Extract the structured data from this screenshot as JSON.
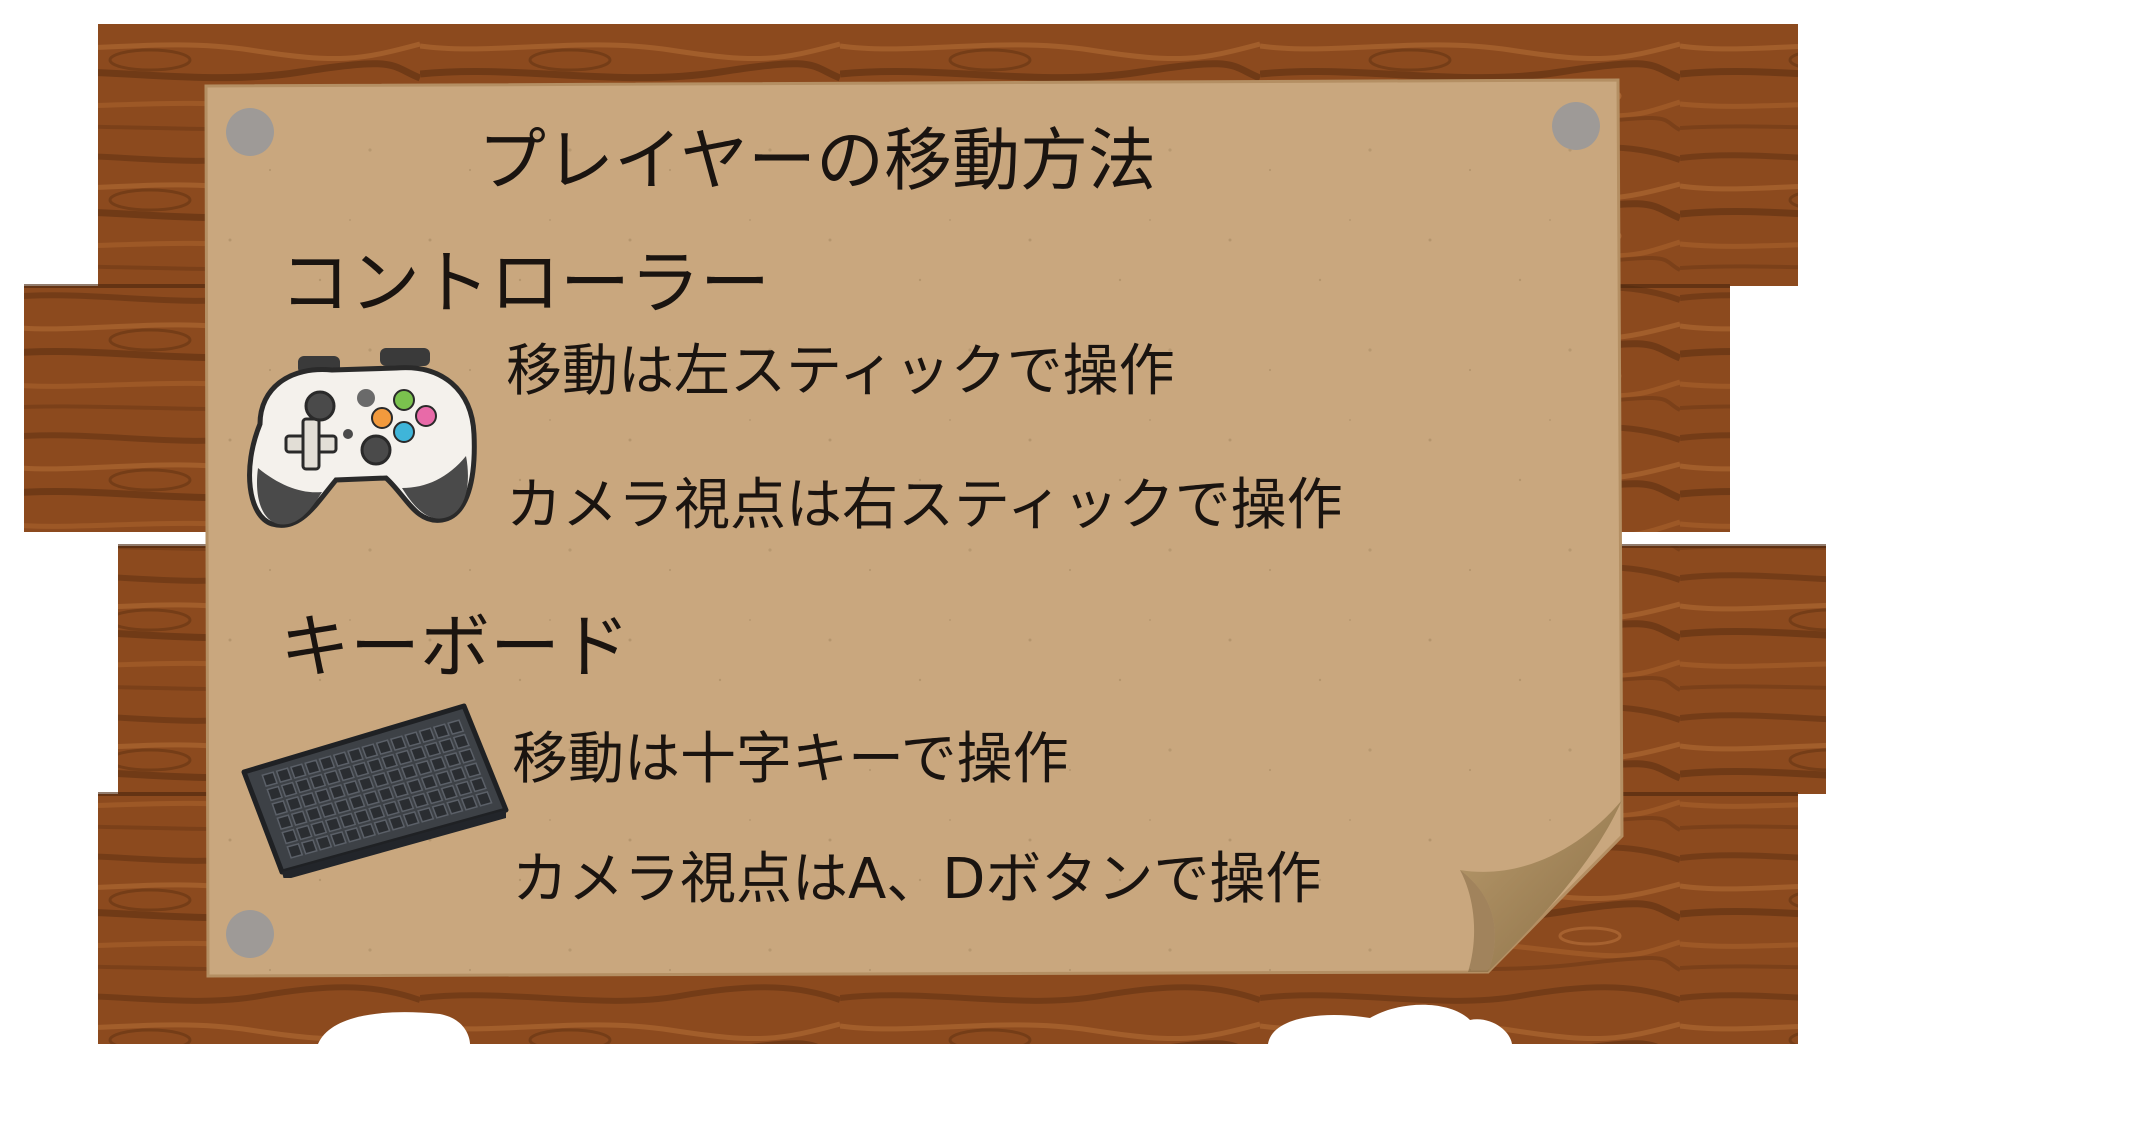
{
  "colors": {
    "wood_base": "#8c4a1e",
    "wood_dark": "#5e2f10",
    "wood_light": "#b06a34",
    "paper": "#c9a77e",
    "paper_edge": "#b48f63",
    "paper_curl": "#9f8152",
    "pin": "#9e9a97",
    "text": "#1a1410",
    "controller_body": "#f4f1ec",
    "controller_grip": "#4a4a4a",
    "keyboard_body": "#3d4146",
    "keyboard_key": "#2a2d31",
    "button_yellow": "#f2c53d",
    "button_green": "#7ac24e",
    "button_pink": "#e86aa8",
    "button_cyan": "#3fb5d9",
    "button_orange": "#f29a3d"
  },
  "board": {
    "title": "プレイヤーの移動方法",
    "sections": [
      {
        "heading": "コントローラー",
        "icon": "gamepad-icon",
        "instructions": [
          "移動は左スティックで操作",
          "カメラ視点は右スティックで操作"
        ]
      },
      {
        "heading": "キーボード",
        "icon": "keyboard-icon",
        "instructions": [
          "移動は十字キーで操作",
          "カメラ視点はA、Dボタンで操作"
        ]
      }
    ]
  }
}
